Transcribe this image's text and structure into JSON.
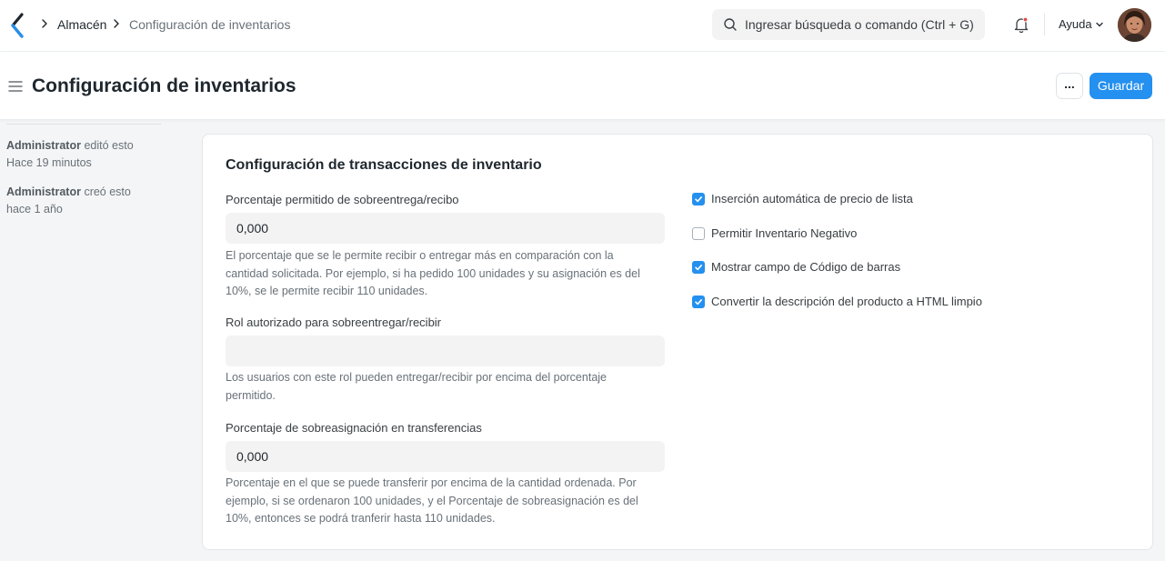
{
  "navbar": {
    "breadcrumbs": [
      "Almacén",
      "Configuración de inventarios"
    ],
    "search_placeholder": "Ingresar búsqueda o comando (Ctrl + G)",
    "help_label": "Ayuda"
  },
  "page": {
    "title": "Configuración de inventarios",
    "more_label": "...",
    "save_label": "Guardar"
  },
  "sidebar": {
    "activity": [
      {
        "user": "Administrator",
        "action": "editó esto",
        "time": "Hace 19 minutos"
      },
      {
        "user": "Administrator",
        "action": "creó esto",
        "time": "hace 1 año"
      }
    ]
  },
  "section": {
    "title": "Configuración de transacciones de inventario",
    "fields": [
      {
        "label": "Porcentaje permitido de sobreentrega/recibo",
        "value": "0,000",
        "description": "El porcentaje que se le permite recibir o entregar más en comparación con la cantidad solicitada. Por ejemplo, si ha pedido 100 unidades y su asignación es del 10%, se le permite recibir 110 unidades."
      },
      {
        "label": "Rol autorizado para sobreentregar/recibir",
        "value": "",
        "description": "Los usuarios con este rol pueden entregar/recibir por encima del porcentaje permitido."
      },
      {
        "label": "Porcentaje de sobreasignación en transferencias",
        "value": "0,000",
        "description": "Porcentaje en el que se puede transferir por encima de la cantidad ordenada. Por ejemplo, si se ordenaron 100 unidades, y el Porcentaje de sobreasignación es del 10%, entonces se podrá tranferir hasta 110 unidades."
      }
    ],
    "checkboxes": [
      {
        "label": "Inserción automática de precio de lista",
        "checked": true
      },
      {
        "label": "Permitir Inventario Negativo",
        "checked": false
      },
      {
        "label": "Mostrar campo de Código de barras",
        "checked": true
      },
      {
        "label": "Convertir la descripción del producto a HTML limpio",
        "checked": true
      }
    ]
  },
  "colors": {
    "primary": "#2490ef",
    "notification_dot": "#e24c4c"
  },
  "icons": [
    "app-logo-icon",
    "chevron-right-icon",
    "search-icon",
    "bell-icon",
    "chevron-down-icon",
    "hamburger-icon",
    "checkmark-icon"
  ]
}
